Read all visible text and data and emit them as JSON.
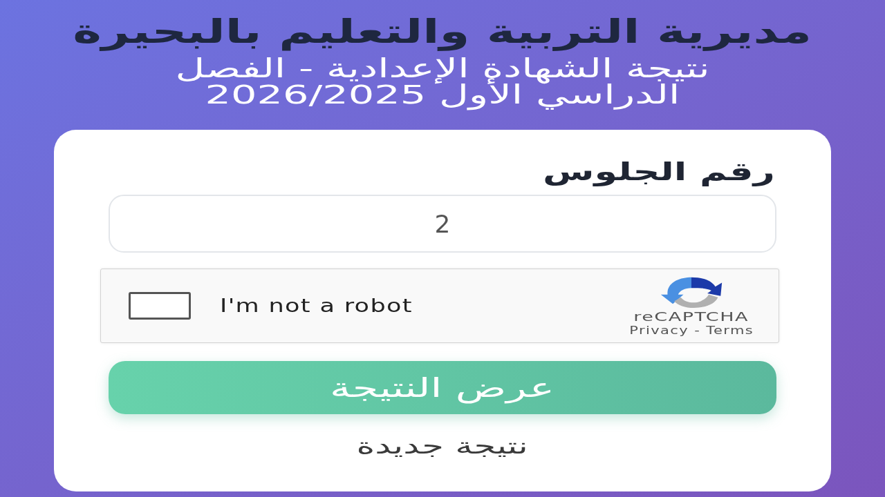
{
  "header": {
    "title": "مديرية التربية والتعليم بالبحيرة",
    "subtitle": "نتيجة الشهادة الإعدادية - الفصل الدراسي الأول 2026/2025"
  },
  "form": {
    "seat_number": {
      "label": "رقم الجلوس",
      "value": "2"
    },
    "captcha": {
      "checked": false,
      "label": "I'm not a robot",
      "brand": "reCAPTCHA",
      "legal": "Privacy - Terms"
    },
    "submit_button": "عرض النتيجة",
    "new_result_link": "نتيجة جديدة"
  }
}
